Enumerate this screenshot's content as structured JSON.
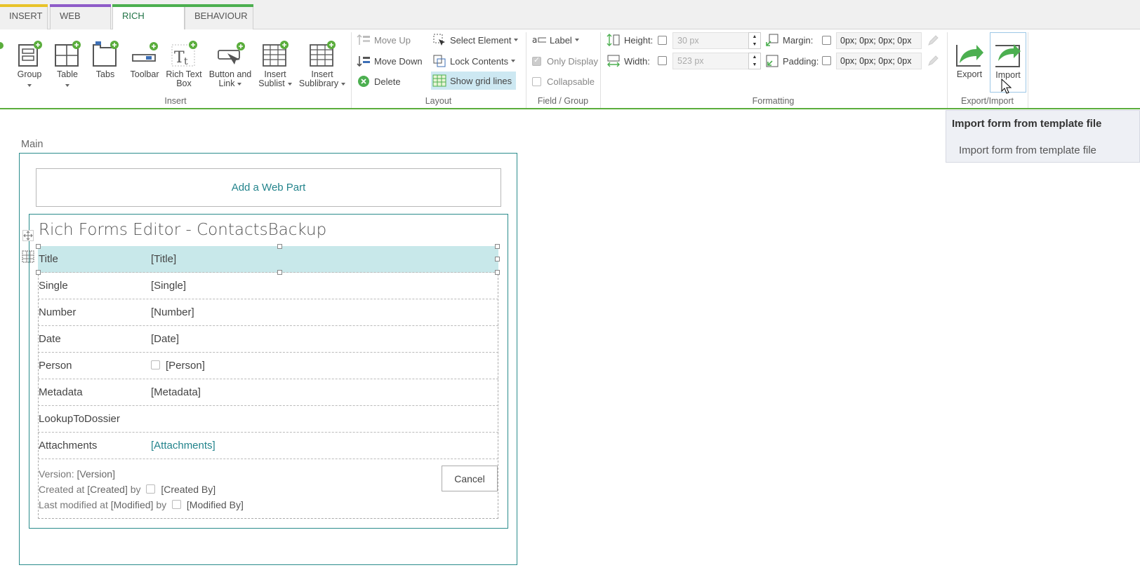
{
  "tabs": [
    {
      "label": "INSERT",
      "accent": "#e8c32a"
    },
    {
      "label": "WEB PART",
      "accent": "#8e5cc8"
    },
    {
      "label": "RICH FORMS",
      "accent": "#4caf50"
    },
    {
      "label": "BEHAVIOUR",
      "accent": "#4caf50"
    }
  ],
  "ribbon": {
    "insert": {
      "group_label": "Insert",
      "buttons": [
        {
          "label_1": "Group",
          "label_2": "",
          "icon": "group-icon"
        },
        {
          "label_1": "Table",
          "label_2": "",
          "icon": "table-icon"
        },
        {
          "label_1": "Tabs",
          "label_2": "",
          "icon": "tabs-icon"
        },
        {
          "label_1": "Toolbar",
          "label_2": "",
          "icon": "toolbar-icon"
        },
        {
          "label_1": "Rich Text",
          "label_2": "Box",
          "icon": "rich-text-icon"
        },
        {
          "label_1": "Button and",
          "label_2": "Link",
          "icon": "button-link-icon"
        },
        {
          "label_1": "Insert",
          "label_2": "Sublist",
          "icon": "sublist-icon"
        },
        {
          "label_1": "Insert",
          "label_2": "Sublibrary",
          "icon": "sublibrary-icon"
        }
      ]
    },
    "layout": {
      "group_label": "Layout",
      "move_up": "Move Up",
      "move_down": "Move Down",
      "delete": "Delete",
      "select_element": "Select Element",
      "lock_contents": "Lock Contents",
      "show_grid_lines": "Show grid lines"
    },
    "field_group": {
      "group_label": "Field / Group",
      "label": "Label",
      "only_display": "Only Display",
      "collapsable": "Collapsable"
    },
    "formatting": {
      "group_label": "Formatting",
      "height_label": "Height:",
      "height_value": "30 px",
      "width_label": "Width:",
      "width_value": "523 px",
      "margin_label": "Margin:",
      "margin_value": "0px; 0px; 0px; 0px",
      "padding_label": "Padding:",
      "padding_value": "0px; 0px; 0px; 0px"
    },
    "export_import": {
      "group_label": "Export/Import",
      "export": "Export",
      "import": "Import"
    }
  },
  "tooltip": {
    "title": "Import form from template file",
    "description": "Import form from template file"
  },
  "canvas": {
    "zone_label": "Main",
    "add_web_part": "Add a Web Part",
    "form_title": "Rich Forms Editor - ContactsBackup",
    "rows": [
      {
        "label": "Title",
        "value": "[Title]"
      },
      {
        "label": "Single",
        "value": "[Single]"
      },
      {
        "label": "Number",
        "value": "[Number]"
      },
      {
        "label": "Date",
        "value": "[Date]"
      },
      {
        "label": "Person",
        "value": "[Person]"
      },
      {
        "label": "Metadata",
        "value": "[Metadata]"
      },
      {
        "label": "LookupToDossier",
        "value": ""
      },
      {
        "label": "Attachments",
        "value": "[Attachments]"
      }
    ],
    "footer": {
      "version_label": "Version:",
      "version_value": "[Version]",
      "created_label": "Created at",
      "created_value": "[Created]",
      "by_1": "by",
      "created_by": "[Created By]",
      "modified_label": "Last modified at",
      "modified_value": "[Modified]",
      "by_2": "by",
      "modified_by": "[Modified By]"
    },
    "cancel": "Cancel"
  },
  "colors": {
    "accent_teal": "#2a8c8c",
    "ribbon_green": "#5aad3c",
    "selection": "#c8e8ea"
  }
}
